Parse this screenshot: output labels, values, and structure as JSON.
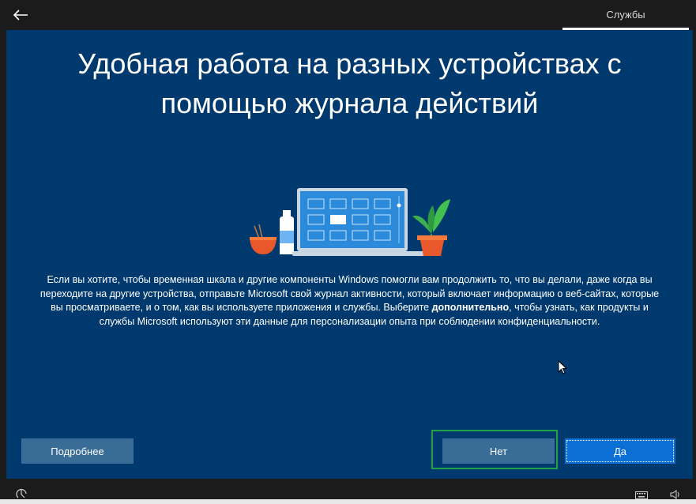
{
  "header": {
    "back_label": "←",
    "section": "Службы"
  },
  "main": {
    "title": "Удобная работа на разных устройствах с помощью журнала действий",
    "description_pre": "Если вы хотите, чтобы временная шкала и другие компоненты Windows помогли вам продолжить то, что вы делали, даже когда вы переходите на другие устройства, отправьте Microsoft свой журнал активности, который включает информацию о веб-сайтах, которые вы просматриваете, и о том, как вы используете приложения и службы. Выберите ",
    "description_bold": "дополнительно",
    "description_post": ", чтобы узнать, как продукты и службы Microsoft используют эти данные для персонализации опыта при соблюдении конфиденциальности."
  },
  "buttons": {
    "more": "Подробнее",
    "no": "Нет",
    "yes": "Да"
  },
  "icons": {
    "back": "back-arrow-icon",
    "illustration": "laptop-plant-illustration",
    "cursor": "mouse-cursor-icon",
    "accessibility": "accessibility-icon",
    "keyboard": "keyboard-icon",
    "volume": "volume-icon"
  },
  "colors": {
    "background": "#00396e",
    "accent": "#0b6fd6",
    "secondary_button": "#3a6c98",
    "highlight": "#1fa346"
  }
}
